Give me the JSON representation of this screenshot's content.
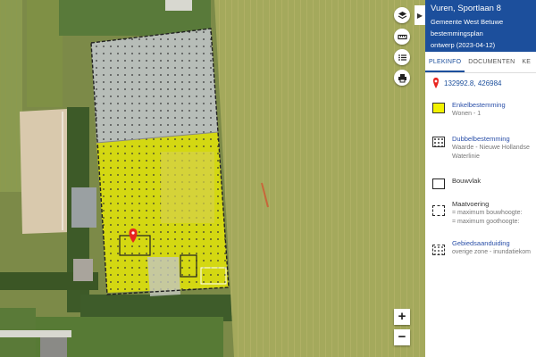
{
  "panel": {
    "title": "Vuren, Sportlaan 8",
    "municipality": "Gemeente West Betuwe",
    "plan_type": "bestemmingsplan",
    "plan_status": "ontwerp (2023-04-12)",
    "collapse_icon": "chevron-right-icon"
  },
  "tabs": [
    {
      "label": "PLEKINFO",
      "active": true
    },
    {
      "label": "DOCUMENTEN",
      "active": false
    },
    {
      "label": "KE",
      "active": false
    }
  ],
  "location": {
    "coordinates": "132992.8, 426984",
    "icon": "map-pin-icon"
  },
  "legend": [
    {
      "name": "Enkelbestemming",
      "lines": [
        "Wonen - 1"
      ],
      "symbol": "yellow-fill"
    },
    {
      "name": "Dubbelbestemming",
      "lines": [
        "Waarde - Nieuwe Hollandse",
        "Waterlinie"
      ],
      "symbol": "dotted-box"
    },
    {
      "name": "Bouwvlak",
      "lines": [],
      "symbol": "solid-box"
    },
    {
      "name": "Maatvoering",
      "lines": [
        "= maximum bouwhoogte: ",
        "= maximum goothoogte: "
      ],
      "symbol": "dashed-box"
    },
    {
      "name": "Gebiedsaanduiding",
      "lines": [
        "overige zone - inundatiekom"
      ],
      "symbol": "hatched-box"
    }
  ],
  "map_tools": [
    {
      "name": "layers-icon"
    },
    {
      "name": "ruler-icon"
    },
    {
      "name": "list-icon"
    },
    {
      "name": "print-icon"
    }
  ],
  "zoom": {
    "in_label": "+",
    "out_label": "−"
  },
  "colors": {
    "header_blue": "#1c4f9c",
    "link_blue": "#2a4fa8",
    "plan_yellow": "#f2f200",
    "pin_red": "#e8251f"
  }
}
